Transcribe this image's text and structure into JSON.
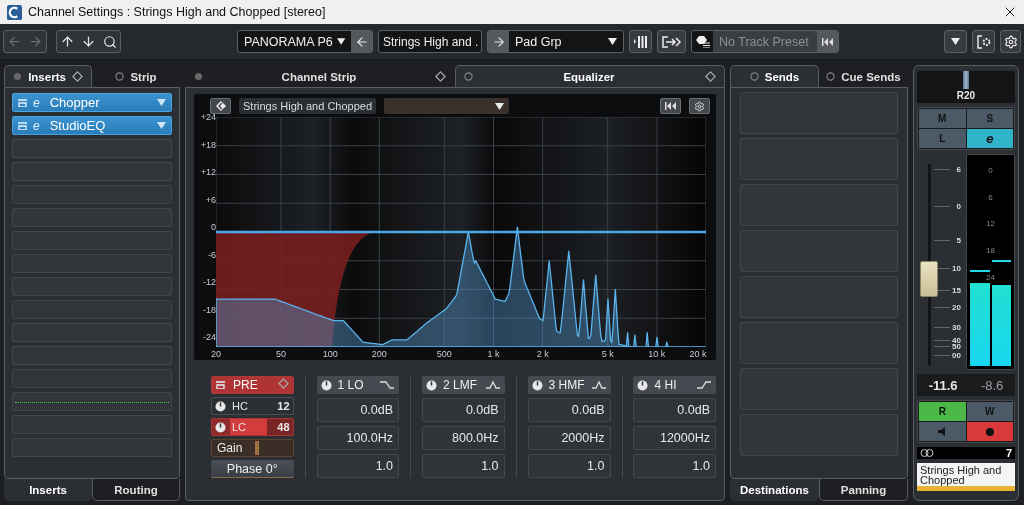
{
  "window": {
    "title": "Channel Settings : Strings High and Chopped [stereo]"
  },
  "toolbar": {
    "back_disabled": true,
    "preset": "PANORAMA P6",
    "channel_name": "Strings High and .",
    "group": "Pad Grp",
    "track_preset": {
      "placeholder": "No Track Preset"
    }
  },
  "inserts": {
    "tabs": [
      {
        "label": "Inserts",
        "selected": true
      },
      {
        "label": "Strip",
        "selected": false
      }
    ],
    "slots": [
      {
        "kind": "plugin",
        "name": "Chopper",
        "edit": "e"
      },
      {
        "kind": "plugin",
        "name": "StudioEQ",
        "edit": "e"
      },
      {
        "kind": "empty"
      },
      {
        "kind": "empty"
      },
      {
        "kind": "empty"
      },
      {
        "kind": "empty"
      },
      {
        "kind": "empty"
      },
      {
        "kind": "empty"
      },
      {
        "kind": "empty"
      },
      {
        "kind": "empty"
      },
      {
        "kind": "empty"
      },
      {
        "kind": "empty"
      },
      {
        "kind": "empty"
      },
      {
        "kind": "meter"
      },
      {
        "kind": "empty"
      },
      {
        "kind": "empty"
      }
    ],
    "bottom_tabs": [
      {
        "label": "Inserts",
        "selected": true
      },
      {
        "label": "Routing",
        "selected": false
      }
    ]
  },
  "center": {
    "tabs": [
      {
        "label": "Channel Strip",
        "selected": false
      },
      {
        "label": "Equalizer",
        "selected": true
      }
    ],
    "preset_label": "Strings High and Chopped",
    "graph": {
      "y_labels": [
        "+24",
        "+18",
        "+12",
        "+6",
        "0",
        "-6",
        "-12",
        "-18",
        "-24"
      ],
      "x_labels": [
        "20",
        "50",
        "100",
        "200",
        "500",
        "1 k",
        "2 k",
        "5 k",
        "10 k",
        "20 k"
      ]
    },
    "pre": {
      "label": "PRE",
      "on": true
    },
    "hc": {
      "label": "HC",
      "value": "12",
      "on": false
    },
    "lc": {
      "label": "LC",
      "value": "48",
      "on": true
    },
    "gain": {
      "label": "Gain",
      "level": 0.52
    },
    "phase": {
      "label": "Phase 0°"
    },
    "bands": [
      {
        "name": "1 LO",
        "kind": "lowshelf",
        "on": true,
        "gain": "0.0dB",
        "freq": "100.0Hz",
        "q": "1.0"
      },
      {
        "name": "2 LMF",
        "kind": "peak",
        "on": true,
        "gain": "0.0dB",
        "freq": "800.0Hz",
        "q": "1.0"
      },
      {
        "name": "3 HMF",
        "kind": "peak",
        "on": true,
        "gain": "0.0dB",
        "freq": "2000Hz",
        "q": "1.0"
      },
      {
        "name": "4 HI",
        "kind": "highshelf",
        "on": true,
        "gain": "0.0dB",
        "freq": "12000Hz",
        "q": "1.0"
      }
    ]
  },
  "sends": {
    "tabs": [
      {
        "label": "Sends",
        "selected": true
      },
      {
        "label": "Cue Sends",
        "selected": false
      }
    ],
    "slot_count_visible": [
      {
        "kind": "empty"
      },
      {
        "kind": "empty"
      },
      {
        "kind": "empty"
      },
      {
        "kind": "empty"
      },
      {
        "kind": "empty"
      },
      {
        "kind": "empty"
      },
      {
        "kind": "empty"
      },
      {
        "kind": "empty"
      }
    ],
    "bottom_tabs": [
      {
        "label": "Destinations",
        "selected": true
      },
      {
        "label": "Panning",
        "selected": false
      }
    ]
  },
  "fader": {
    "pan": "R20",
    "buttons": [
      {
        "label": "M",
        "on": false
      },
      {
        "label": "S",
        "on": false
      },
      {
        "label": "L",
        "on": false
      },
      {
        "label": "e",
        "on": true
      }
    ],
    "scale": [
      "6",
      "0",
      "5",
      "10",
      "15",
      "20",
      "30",
      "40",
      "50",
      "00"
    ],
    "level": 0.42,
    "meter_labels": [
      "0",
      "6",
      "12",
      "18",
      "24"
    ],
    "meters": [
      {
        "level": 0.4,
        "peak_hold": {
          "level": 0.45
        }
      },
      {
        "level": 0.39,
        "peak_hold": {
          "level": 0.5
        }
      }
    ],
    "volume": "-11.6",
    "peak_reading": "-8.6",
    "read": {
      "label": "R",
      "on": true
    },
    "write": {
      "label": "W",
      "on": false
    },
    "monitor": {
      "on": false
    },
    "record": {
      "on": true
    },
    "number": "7",
    "name": "Strings High and Chopped",
    "color": "#e8b436"
  }
}
